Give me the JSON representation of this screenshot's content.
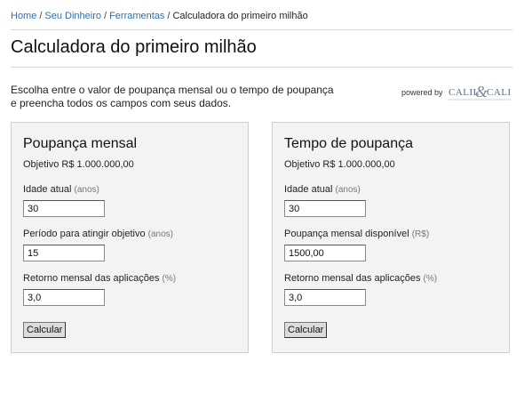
{
  "breadcrumb": {
    "items": [
      "Home",
      "Seu Dinheiro",
      "Ferramentas"
    ],
    "current": "Calculadora do primeiro milhão",
    "separator": "/"
  },
  "page_title": "Calculadora do primeiro milhão",
  "intro": {
    "line1": "Escolha entre o valor de poupança mensal ou o tempo de poupança",
    "line2": "e preencha todos os campos com seus dados."
  },
  "powered_by": {
    "label": "powered by",
    "logo_text": "Calil&Calil"
  },
  "colors": {
    "link": "#2f6fa8",
    "panel_bg": "#f3f3f3",
    "panel_border": "#cfcfcf"
  },
  "panels": {
    "monthly": {
      "title": "Poupança mensal",
      "goal": "Objetivo R$ 1.000.000,00",
      "fields": [
        {
          "label": "Idade atual",
          "unit": "(anos)",
          "value": "30"
        },
        {
          "label": "Período para atingir objetivo",
          "unit": "(anos)",
          "value": "15"
        },
        {
          "label": "Retorno mensal das aplicações",
          "unit": "(%)",
          "value": "3,0"
        }
      ],
      "button": "Calcular"
    },
    "time": {
      "title": "Tempo de poupança",
      "goal": "Objetivo R$ 1.000.000,00",
      "fields": [
        {
          "label": "Idade atual",
          "unit": "(anos)",
          "value": "30"
        },
        {
          "label": "Poupança mensal disponível",
          "unit": "(R$)",
          "value": "1500,00"
        },
        {
          "label": "Retorno mensal das aplicações",
          "unit": "(%)",
          "value": "3,0"
        }
      ],
      "button": "Calcular"
    }
  }
}
